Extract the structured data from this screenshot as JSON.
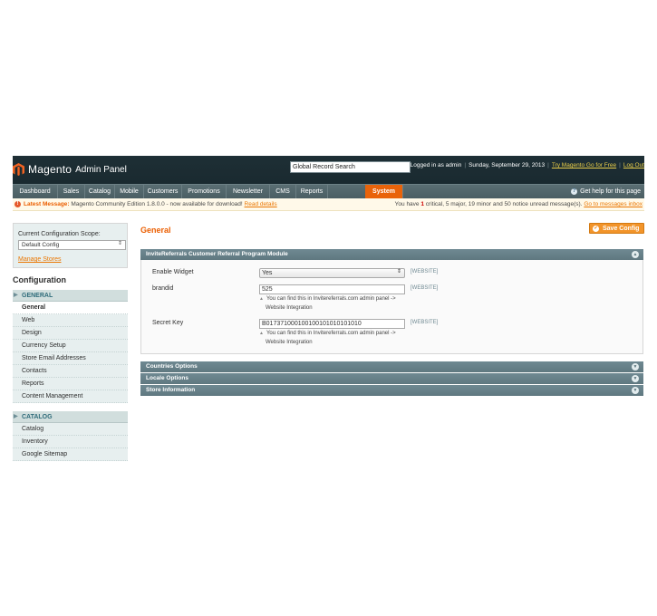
{
  "header": {
    "logo_text": "Magento",
    "logo_sub": "Admin Panel",
    "search_value": "Global Record Search",
    "logged_in": "Logged in as admin",
    "date": "Sunday, September 29, 2013",
    "try_go": "Try Magento Go for Free",
    "logout": "Log Out"
  },
  "nav": {
    "items": [
      "Dashboard",
      "Sales",
      "Catalog",
      "Mobile",
      "Customers",
      "Promotions",
      "Newsletter",
      "CMS",
      "Reports",
      "System"
    ],
    "active": "System",
    "help": "Get help for this page"
  },
  "message": {
    "latest_label": "Latest Message:",
    "latest_text": "Magento Community Edition 1.8.0.0 - now available for download!",
    "read_details": "Read details",
    "right_prefix": "You have",
    "critical_count": "1",
    "critical_label": "critical",
    "right_rest": ", 5 major, 19 minor and 50 notice unread message(s).",
    "inbox_link": "Go to messages inbox"
  },
  "sidebar": {
    "scope_label": "Current Configuration Scope:",
    "scope_value": "Default Config",
    "manage_stores": "Manage Stores",
    "config_title": "Configuration",
    "group_general": "GENERAL",
    "general_items": [
      "General",
      "Web",
      "Design",
      "Currency Setup",
      "Store Email Addresses",
      "Contacts",
      "Reports",
      "Content Management"
    ],
    "group_catalog": "CATALOG",
    "catalog_items": [
      "Catalog",
      "Inventory",
      "Google Sitemap"
    ]
  },
  "main": {
    "title": "General",
    "save_label": "Save Config",
    "fieldset_title": "InviteReferrals Customer Referral Program Module",
    "enable_label": "Enable Widget",
    "enable_value": "Yes",
    "brandid_label": "brandid",
    "brandid_value": "525",
    "secret_label": "Secret Key",
    "secret_value": "B017371000100100101010101010",
    "scope_tag": "[WEBSITE]",
    "note_line1": "You can find this in Invitereferrals.com admin panel ->",
    "note_line2": "Website Integration",
    "collapsed_sections": [
      "Countries Options",
      "Locale Options",
      "Store Information"
    ]
  },
  "colors": {
    "accent": "#eb5e00",
    "header_bg": "#1e2f35",
    "nav_bg": "#53676c",
    "fieldset_head": "#6b848d"
  }
}
